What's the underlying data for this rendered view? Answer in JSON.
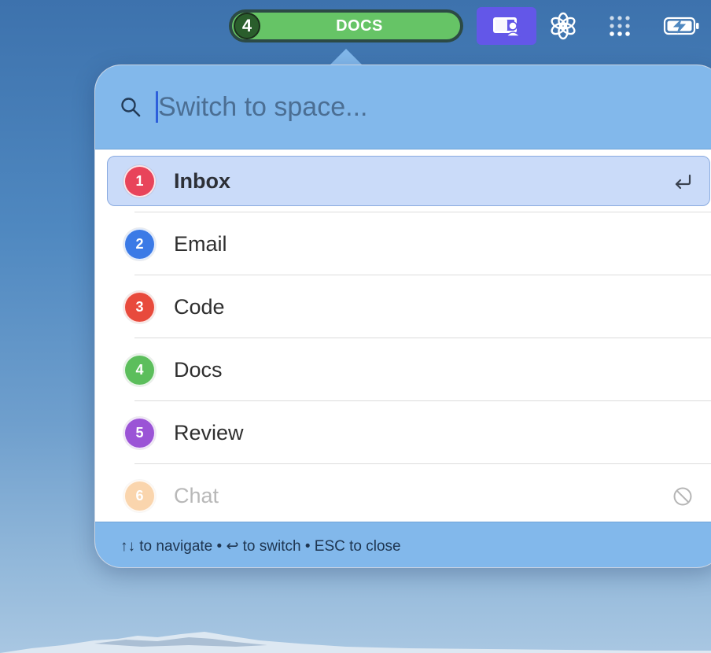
{
  "menubar": {
    "current_space_number": "4",
    "current_space_name": "DOCS",
    "current_space_color": "#66c466",
    "icons": [
      "screen-share-icon",
      "openai-icon",
      "dot-grid-icon",
      "battery-charging-icon"
    ],
    "screen_share_color": "#6357e8"
  },
  "switcher": {
    "search": {
      "placeholder": "Switch to space...",
      "value": ""
    },
    "spaces": [
      {
        "number": "1",
        "name": "Inbox",
        "color": "#e8445a",
        "selected": true,
        "enabled": true,
        "action_icon": "return-icon"
      },
      {
        "number": "2",
        "name": "Email",
        "color": "#3b7ae6",
        "selected": false,
        "enabled": true
      },
      {
        "number": "3",
        "name": "Code",
        "color": "#e84a3c",
        "selected": false,
        "enabled": true
      },
      {
        "number": "4",
        "name": "Docs",
        "color": "#5cbe5c",
        "selected": false,
        "enabled": true
      },
      {
        "number": "5",
        "name": "Review",
        "color": "#9b54d6",
        "selected": false,
        "enabled": true
      },
      {
        "number": "6",
        "name": "Chat",
        "color": "#f5a34c",
        "selected": false,
        "enabled": false,
        "action_icon": "disabled-icon"
      }
    ],
    "footer": {
      "hint": "↑↓ to navigate • ↩ to switch • ESC to close"
    }
  }
}
